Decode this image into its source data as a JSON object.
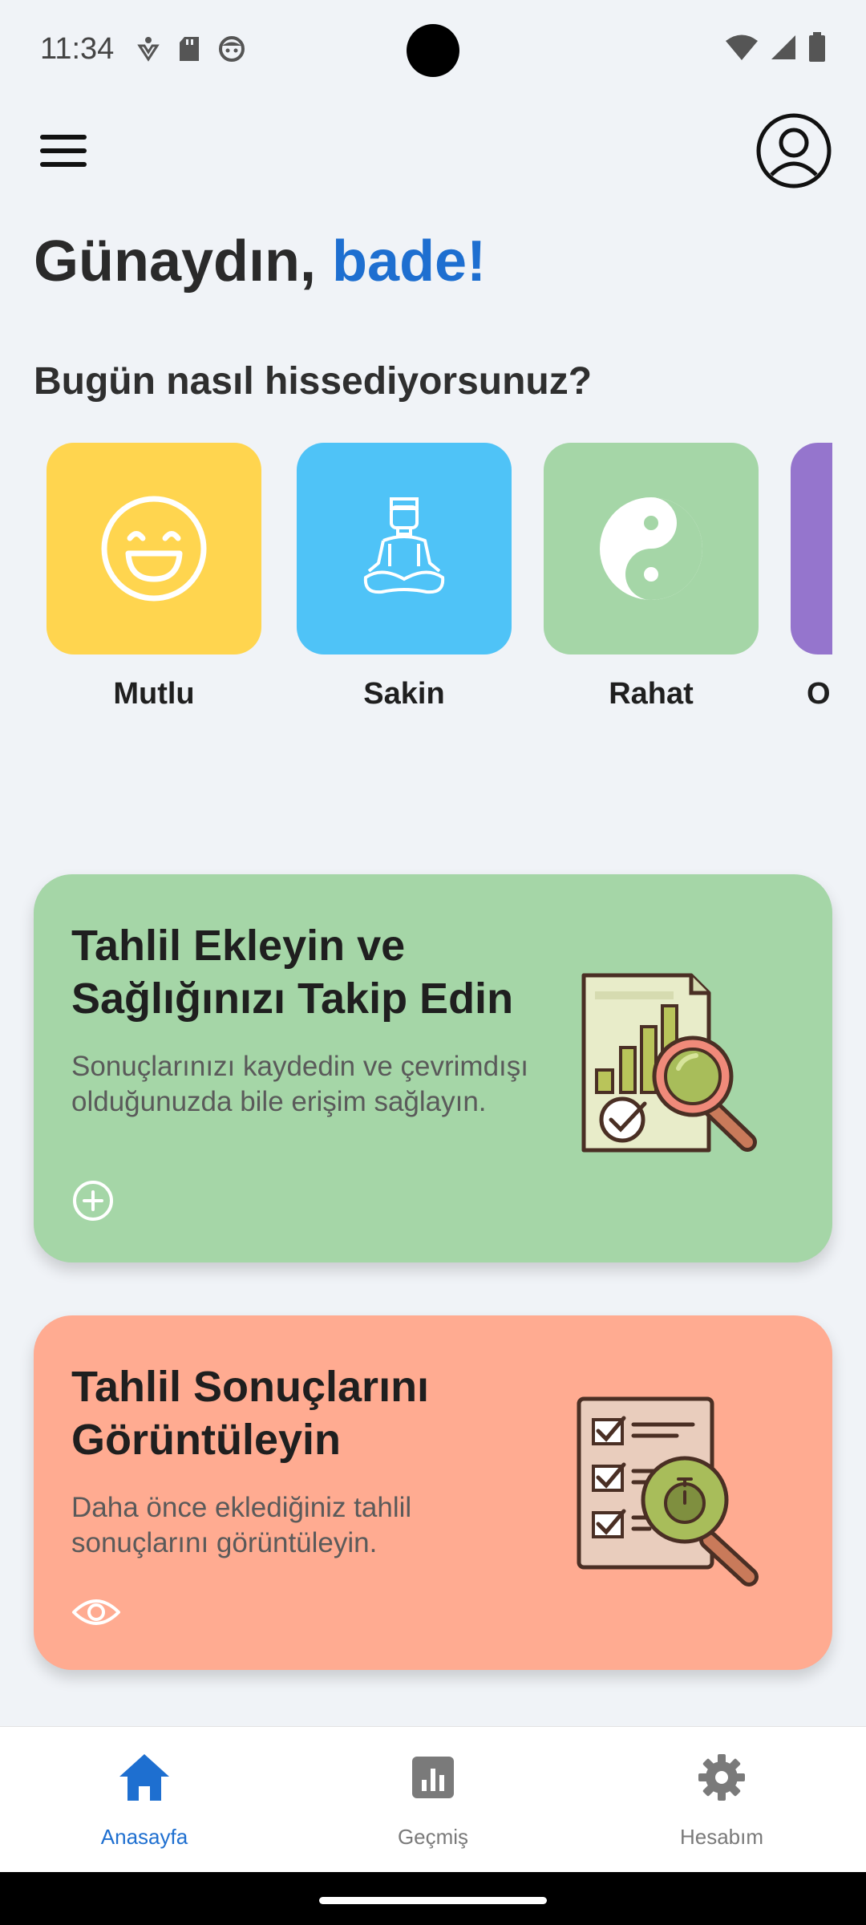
{
  "status_bar": {
    "time": "11:34",
    "left_icons": [
      "accessibility-icon",
      "sd-card-icon",
      "face-icon"
    ],
    "right_icons": [
      "wifi-icon",
      "signal-icon",
      "battery-icon"
    ]
  },
  "header": {
    "menu_icon": "hamburger-menu-icon",
    "profile_icon": "account-circle-icon"
  },
  "greeting": {
    "prefix": "Günaydın,",
    "name": "bade!"
  },
  "mood_question": "Bugün nasıl hissediyorsunuz?",
  "moods": [
    {
      "label": "Mutlu",
      "icon": "laughing-face-icon",
      "color": "#ffd54f"
    },
    {
      "label": "Sakin",
      "icon": "meditation-icon",
      "color": "#4fc3f7"
    },
    {
      "label": "Rahat",
      "icon": "yin-yang-icon",
      "color": "#a5d6a7"
    },
    {
      "label": "O",
      "icon": "",
      "color": "#9575cd"
    }
  ],
  "cards": [
    {
      "title": "Tahlil Ekleyin ve Sağlığınızı Takip Edin",
      "description": "Sonuçlarınızı kaydedin ve çevrimdışı olduğunuzda bile erişim sağlayın.",
      "action_icon": "add-circle-icon",
      "illustration": "report-magnifier-icon",
      "color": "#a5d6a7"
    },
    {
      "title": "Tahlil Sonuçlarını Görüntüleyin",
      "description": "Daha önce eklediğiniz tahlil sonuçlarını görüntüleyin.",
      "action_icon": "eye-icon",
      "illustration": "checklist-magnifier-icon",
      "color": "#ffab91"
    }
  ],
  "bottom_nav": {
    "active_color": "#1e6fd0",
    "inactive_color": "#7a7a7a",
    "items": [
      {
        "label": "Anasayfa",
        "icon": "home-icon",
        "active": true
      },
      {
        "label": "Geçmiş",
        "icon": "bar-chart-icon",
        "active": false
      },
      {
        "label": "Hesabım",
        "icon": "settings-gear-icon",
        "active": false
      }
    ]
  }
}
